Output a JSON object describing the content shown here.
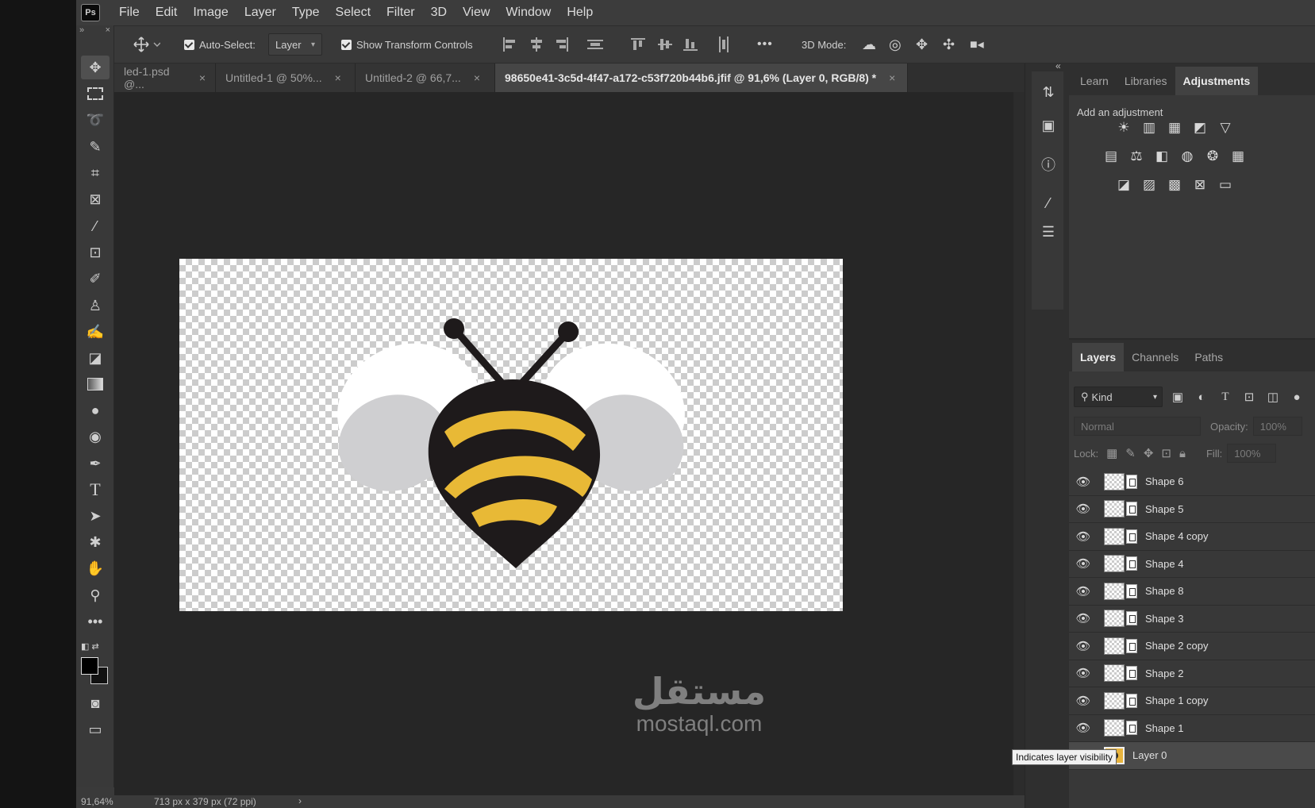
{
  "app": {
    "logo": "Ps"
  },
  "menu": [
    "File",
    "Edit",
    "Image",
    "Layer",
    "Type",
    "Select",
    "Filter",
    "3D",
    "View",
    "Window",
    "Help"
  ],
  "options": {
    "auto_select_label": "Auto-Select:",
    "auto_select_value": "Layer",
    "show_transform_label": "Show Transform Controls",
    "more": "•••",
    "mode_3d_label": "3D Mode:"
  },
  "toolbar": {
    "collapse": "»",
    "close": "×"
  },
  "tabs": [
    {
      "label": "led-1.psd @...",
      "close": "×"
    },
    {
      "label": "Untitled-1 @ 50%...",
      "close": "×"
    },
    {
      "label": "Untitled-2 @ 66,7...",
      "close": "×"
    },
    {
      "label": "98650e41-3c5d-4f47-a172-c53f720b44b6.jfif @ 91,6% (Layer 0, RGB/8) *",
      "close": "×"
    }
  ],
  "status": {
    "zoom": "91,64%",
    "doc_size": "713 px x 379 px (72 ppi)",
    "arrow": "›"
  },
  "dock": {
    "collapse": "«"
  },
  "top_panel": {
    "tabs": [
      "Learn",
      "Libraries",
      "Adjustments"
    ],
    "active": "Adjustments",
    "add_adjustment": "Add an adjustment"
  },
  "layers_panel": {
    "tabs": [
      "Layers",
      "Channels",
      "Paths"
    ],
    "active": "Layers",
    "kind_label": "Kind",
    "blend_mode": "Normal",
    "opacity_label": "Opacity:",
    "opacity_value": "100%",
    "lock_label": "Lock:",
    "fill_label": "Fill:",
    "fill_value": "100%",
    "layers": [
      {
        "name": "Shape 6",
        "visible": true
      },
      {
        "name": "Shape 5",
        "visible": true
      },
      {
        "name": "Shape 4 copy",
        "visible": true
      },
      {
        "name": "Shape 4",
        "visible": true
      },
      {
        "name": "Shape 8",
        "visible": true
      },
      {
        "name": "Shape 3",
        "visible": true
      },
      {
        "name": "Shape 2 copy",
        "visible": true
      },
      {
        "name": "Shape 2",
        "visible": true
      },
      {
        "name": "Shape 1 copy",
        "visible": true
      },
      {
        "name": "Shape 1",
        "visible": true
      },
      {
        "name": "Layer 0",
        "visible": false
      }
    ]
  },
  "tooltip": "Indicates layer visibility",
  "watermark": {
    "arabic": "مستقل",
    "latin": "mostaql.com"
  },
  "colors": {
    "bee_yellow": "#e8b936",
    "bee_black": "#1e1a1b",
    "wing_gray": "#cfcfd1"
  }
}
